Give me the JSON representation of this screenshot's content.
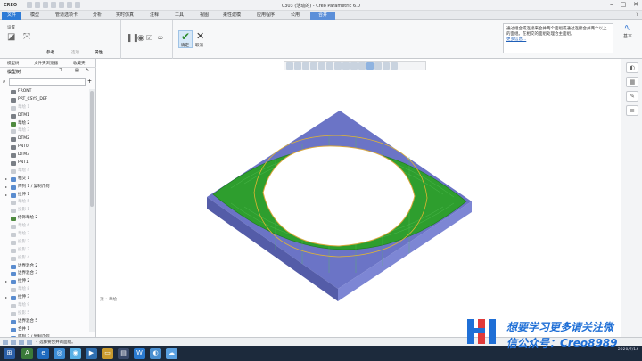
{
  "window": {
    "app_logo": "CREO",
    "title": "0303 (活动的) - Creo Parametric 6.0"
  },
  "ribbon_tabs": [
    "文件",
    "模型",
    "管道选项卡",
    "分析",
    "实时仿真",
    "注释",
    "工具",
    "视图",
    "柔性建模",
    "应用程序",
    "公用",
    "合并"
  ],
  "ribbon": {
    "group_settings_label": "设置",
    "ok_label": "确定",
    "cancel_label": "取消",
    "subtabs": [
      "参考",
      "选项",
      "属性"
    ],
    "right_label": "基本"
  },
  "help": {
    "text": "通过组合或连接来合并两个面组或通过连接合并两个以上的面组。在相交的面组处理合主面组。",
    "link": "更多信息..."
  },
  "left_pane": {
    "tabs": [
      "模型树",
      "文件夹浏览器",
      "收藏夹"
    ],
    "tree_header": "模型树"
  },
  "tree": [
    {
      "label": "FRONT",
      "dim": false,
      "arrow": "",
      "color": "#7a7f86"
    },
    {
      "label": "PRT_CSYS_DEF",
      "dim": false,
      "arrow": "",
      "color": "#7a7f86"
    },
    {
      "label": "草绘 1",
      "dim": true,
      "arrow": "",
      "color": "#c8ccd2"
    },
    {
      "label": "DTM1",
      "dim": false,
      "arrow": "",
      "color": "#7a7f86"
    },
    {
      "label": "草绘 2",
      "dim": false,
      "arrow": "",
      "color": "#4f8a3f"
    },
    {
      "label": "草绘 3",
      "dim": true,
      "arrow": "",
      "color": "#c8ccd2"
    },
    {
      "label": "DTM2",
      "dim": false,
      "arrow": "",
      "color": "#7a7f86"
    },
    {
      "label": "PNT0",
      "dim": false,
      "arrow": "",
      "color": "#7a7f86"
    },
    {
      "label": "DTM3",
      "dim": false,
      "arrow": "",
      "color": "#7a7f86"
    },
    {
      "label": "PNT1",
      "dim": false,
      "arrow": "",
      "color": "#7a7f86"
    },
    {
      "label": "草绘 4",
      "dim": true,
      "arrow": "",
      "color": "#c8ccd2"
    },
    {
      "label": "相交 1",
      "dim": false,
      "arrow": "▸",
      "color": "#5a8ccf"
    },
    {
      "label": "阵列 1 / 复制几何",
      "dim": false,
      "arrow": "▸",
      "color": "#5a8ccf"
    },
    {
      "label": "拉伸 1",
      "dim": false,
      "arrow": "▸",
      "color": "#5a8ccf"
    },
    {
      "label": "草绘 5",
      "dim": true,
      "arrow": "",
      "color": "#c8ccd2"
    },
    {
      "label": "投影 1",
      "dim": true,
      "arrow": "",
      "color": "#c8ccd2"
    },
    {
      "label": "修饰草绘 2",
      "dim": false,
      "arrow": "",
      "color": "#4f8a3f"
    },
    {
      "label": "草绘 6",
      "dim": true,
      "arrow": "",
      "color": "#c8ccd2"
    },
    {
      "label": "草绘 7",
      "dim": true,
      "arrow": "",
      "color": "#c8ccd2"
    },
    {
      "label": "投影 2",
      "dim": true,
      "arrow": "",
      "color": "#c8ccd2"
    },
    {
      "label": "投影 3",
      "dim": true,
      "arrow": "",
      "color": "#c8ccd2"
    },
    {
      "label": "投影 4",
      "dim": true,
      "arrow": "",
      "color": "#c8ccd2"
    },
    {
      "label": "边界混合 2",
      "dim": false,
      "arrow": "",
      "color": "#5a8ccf"
    },
    {
      "label": "边界混合 3",
      "dim": false,
      "arrow": "",
      "color": "#5a8ccf"
    },
    {
      "label": "拉伸 2",
      "dim": false,
      "arrow": "▸",
      "color": "#5a8ccf"
    },
    {
      "label": "草绘 8",
      "dim": true,
      "arrow": "",
      "color": "#c8ccd2"
    },
    {
      "label": "拉伸 3",
      "dim": false,
      "arrow": "▸",
      "color": "#5a8ccf"
    },
    {
      "label": "草绘 9",
      "dim": true,
      "arrow": "",
      "color": "#c8ccd2"
    },
    {
      "label": "投影 5",
      "dim": true,
      "arrow": "",
      "color": "#c8ccd2"
    },
    {
      "label": "边界混合 5",
      "dim": false,
      "arrow": "",
      "color": "#5a8ccf"
    },
    {
      "label": "合并 1",
      "dim": false,
      "arrow": "",
      "color": "#5a8ccf"
    },
    {
      "label": "阵列 3 / 复制几何",
      "dim": false,
      "arrow": "▸",
      "color": "#5a8ccf"
    }
  ],
  "graphics": {
    "hint": "顶 • 草绘",
    "surface_color": "#2fa52f",
    "frame_color": "#6f78c8"
  },
  "status": {
    "message": "• 选择要合并的面组。"
  },
  "watermark": {
    "line1": "想要学习更多请关注微",
    "line2": "信公众号：Creo8989"
  },
  "tray": {
    "time": "",
    "date": "2020/7/14"
  }
}
